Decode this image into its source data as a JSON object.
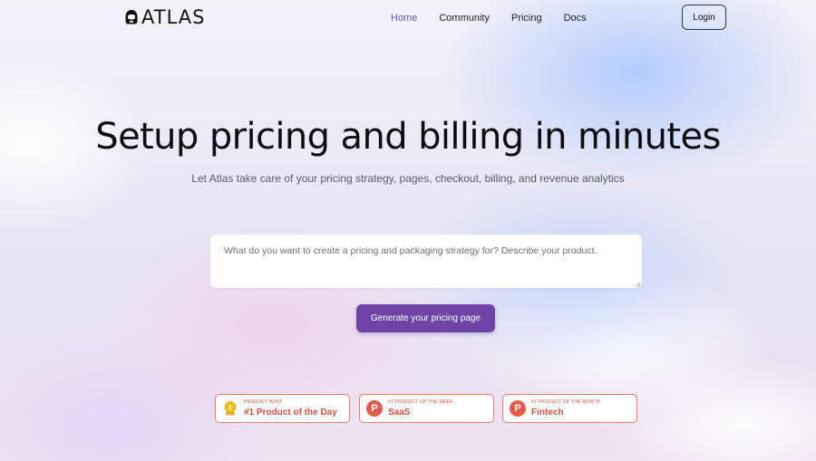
{
  "brand": {
    "name": "ATLAS",
    "icon": "astronaut-helmet-icon"
  },
  "nav": {
    "items": [
      {
        "label": "Home",
        "active": true
      },
      {
        "label": "Community",
        "active": false
      },
      {
        "label": "Pricing",
        "active": false
      },
      {
        "label": "Docs",
        "active": false
      }
    ],
    "login_label": "Login"
  },
  "hero": {
    "title": "Setup pricing and billing in minutes",
    "subtitle": "Let Atlas take care of your pricing strategy, pages, checkout, billing, and revenue analytics"
  },
  "prompt": {
    "placeholder": "What do you want to create a pricing and packaging strategy for? Describe your product.",
    "value": ""
  },
  "generate_label": "Generate your pricing page",
  "badges": [
    {
      "kicker": "PRODUCT HUNT",
      "title": "#1 Product of the Day",
      "icon": "gold-medal-icon"
    },
    {
      "kicker": "#1 PRODUCT OF THE WEEK",
      "title": "SaaS",
      "icon": "product-hunt-icon",
      "icon_letter": "P"
    },
    {
      "kicker": "#1 PRODUCT OF THE MONTH",
      "title": "Fintech",
      "icon": "product-hunt-icon",
      "icon_letter": "P"
    }
  ],
  "colors": {
    "accent": "#6e44a6",
    "nav_active": "#6b57a8",
    "badge": "#c6533f",
    "badge_icon": "#e05d4a"
  }
}
